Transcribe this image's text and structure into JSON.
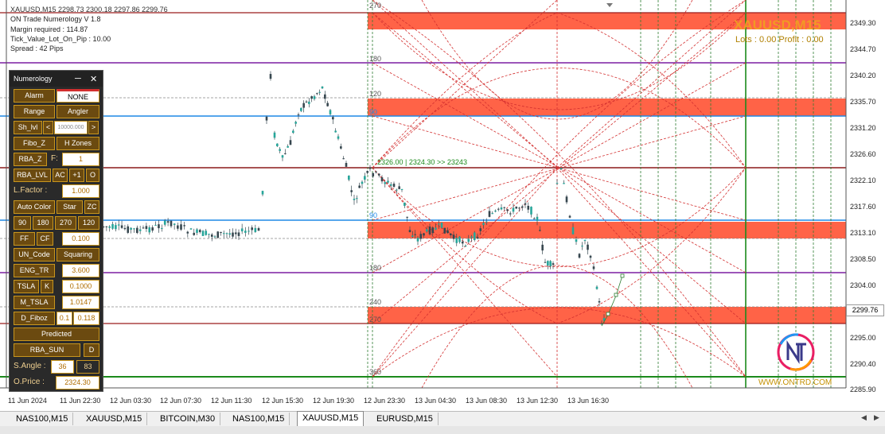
{
  "header": {
    "symbol_line": "XAUUSD,M15  2298.73 2300.18 2297.86 2299.76",
    "indicator": "ON Trade Numerology  V 1.8",
    "margin": "Margin required : 114.87",
    "tick_value": "Tick_Value_Lot_On_Pip : 10.00",
    "spread": "Spread : 42  Pips"
  },
  "overlay": {
    "title": "XAUUSD,M15",
    "lots": "Lots : 0.00 Profit : 0.00",
    "website": "WWW.ONTRD.COM"
  },
  "current_price": "2299.76",
  "price_axis": [
    "2349.30",
    "2344.70",
    "2340.20",
    "2335.70",
    "2331.20",
    "2326.60",
    "2322.10",
    "2317.60",
    "2313.10",
    "2308.50",
    "2304.00",
    "2295.00",
    "2290.40",
    "2285.90"
  ],
  "time_axis": [
    "11 Jun 2024",
    "11 Jun 22:30",
    "12 Jun 03:30",
    "12 Jun 07:30",
    "12 Jun 11:30",
    "12 Jun 15:30",
    "12 Jun 19:30",
    "12 Jun 23:30",
    "13 Jun 04:30",
    "13 Jun 08:30",
    "13 Jun 12:30",
    "13 Jun 16:30"
  ],
  "chart_labels": {
    "l270": "270",
    "l180a": "180",
    "l120": "120",
    "l90a": "90",
    "l90b": "90",
    "l180b": "180",
    "l240": "240",
    "l270b": "270",
    "l360": "360",
    "angle_line": "2326.00 | 2324.30  >> 23243"
  },
  "panel": {
    "title": "Numerology",
    "alarm": "Alarm",
    "none": "NONE",
    "range": "Range",
    "angler": "Angler",
    "sh_lvl": "Sh_lvl",
    "lt": "<",
    "sh_val": "10000.000",
    "gt": ">",
    "fibo_z": "Fibo_Z",
    "h_zones": "H Zones",
    "rba_z": "RBA_Z",
    "f_label": "F:",
    "f_val": "1",
    "rba_lvl": "RBA_LVL",
    "ac": "AC",
    "plus1": "+1",
    "o": "O",
    "l_factor": "L.Factor :",
    "l_factor_val": "1.000",
    "auto_color": "Auto Color",
    "star": "Star",
    "zc": "ZC",
    "b90": "90",
    "b180": "180",
    "b270": "270",
    "b120": "120",
    "ff": "FF",
    "cf": "CF",
    "cf_val": "0.100",
    "un_code": "UN_Code",
    "squaring": "Squaring",
    "eng_tr": "ENG_TR",
    "eng_val": "3.600",
    "tsla": "TSLA",
    "k": "K",
    "tsla_val": "0.1000",
    "m_tsla": "M_TSLA",
    "m_tsla_val": "1.0147",
    "d_fiboz": "D_Fiboz",
    "d_fiboz_a": "0.1",
    "d_fiboz_b": "0.118",
    "predicted": "Predicted",
    "rba_sun": "RBA_SUN",
    "d": "D",
    "s_angle": "S.Angle :",
    "s_angle_val": "36",
    "s_angle_b": "83",
    "o_price": "O.Price :",
    "o_price_val": "2324.30"
  },
  "tabs": [
    "NAS100,M15",
    "XAUUSD,M15",
    "BITCOIN,M30",
    "NAS100,M15",
    "XAUUSD,M15",
    "EURUSD,M15"
  ],
  "active_tab": 4
}
